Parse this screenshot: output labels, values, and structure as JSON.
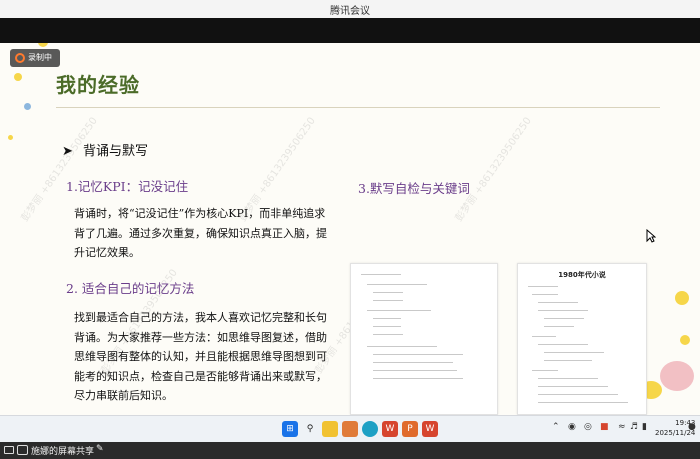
{
  "meeting": {
    "title": "腾讯会议"
  },
  "recording": {
    "label": "录制中"
  },
  "slide": {
    "title": "我的经验",
    "section_heading": "背诵与默写",
    "sub1": "1.记忆KPI：记没记住",
    "para1": "背诵时，将“记没记住”作为核心KPI，而非单纯追求背了几遍。通过多次重复，确保知识点真正入脑，提升记忆效果。",
    "sub2": "2. 适合自己的记忆方法",
    "para2": "找到最适合自己的方法，我本人喜欢记忆完整和长句背诵。为大家推荐一些方法：如思维导图复述，借助思维导图有整体的认知，并且能根据思维导图想到可能考的知识点，检查自己是否能够背诵出来或默写，尽力串联前后知识。",
    "sub3": "3.默写自检与关键词",
    "thumb_right_title": "1980年代小说",
    "watermark": "彭梦丽 +8613239506250"
  },
  "taskbar": {
    "clock_time": "19:43",
    "clock_date": "2025/11/24"
  },
  "share": {
    "label": "施娜的屏幕共享"
  },
  "colors": {
    "title_green": "#4b6b28",
    "subheading_purple": "#6a3d8a",
    "accent_red": "#d6452e"
  }
}
